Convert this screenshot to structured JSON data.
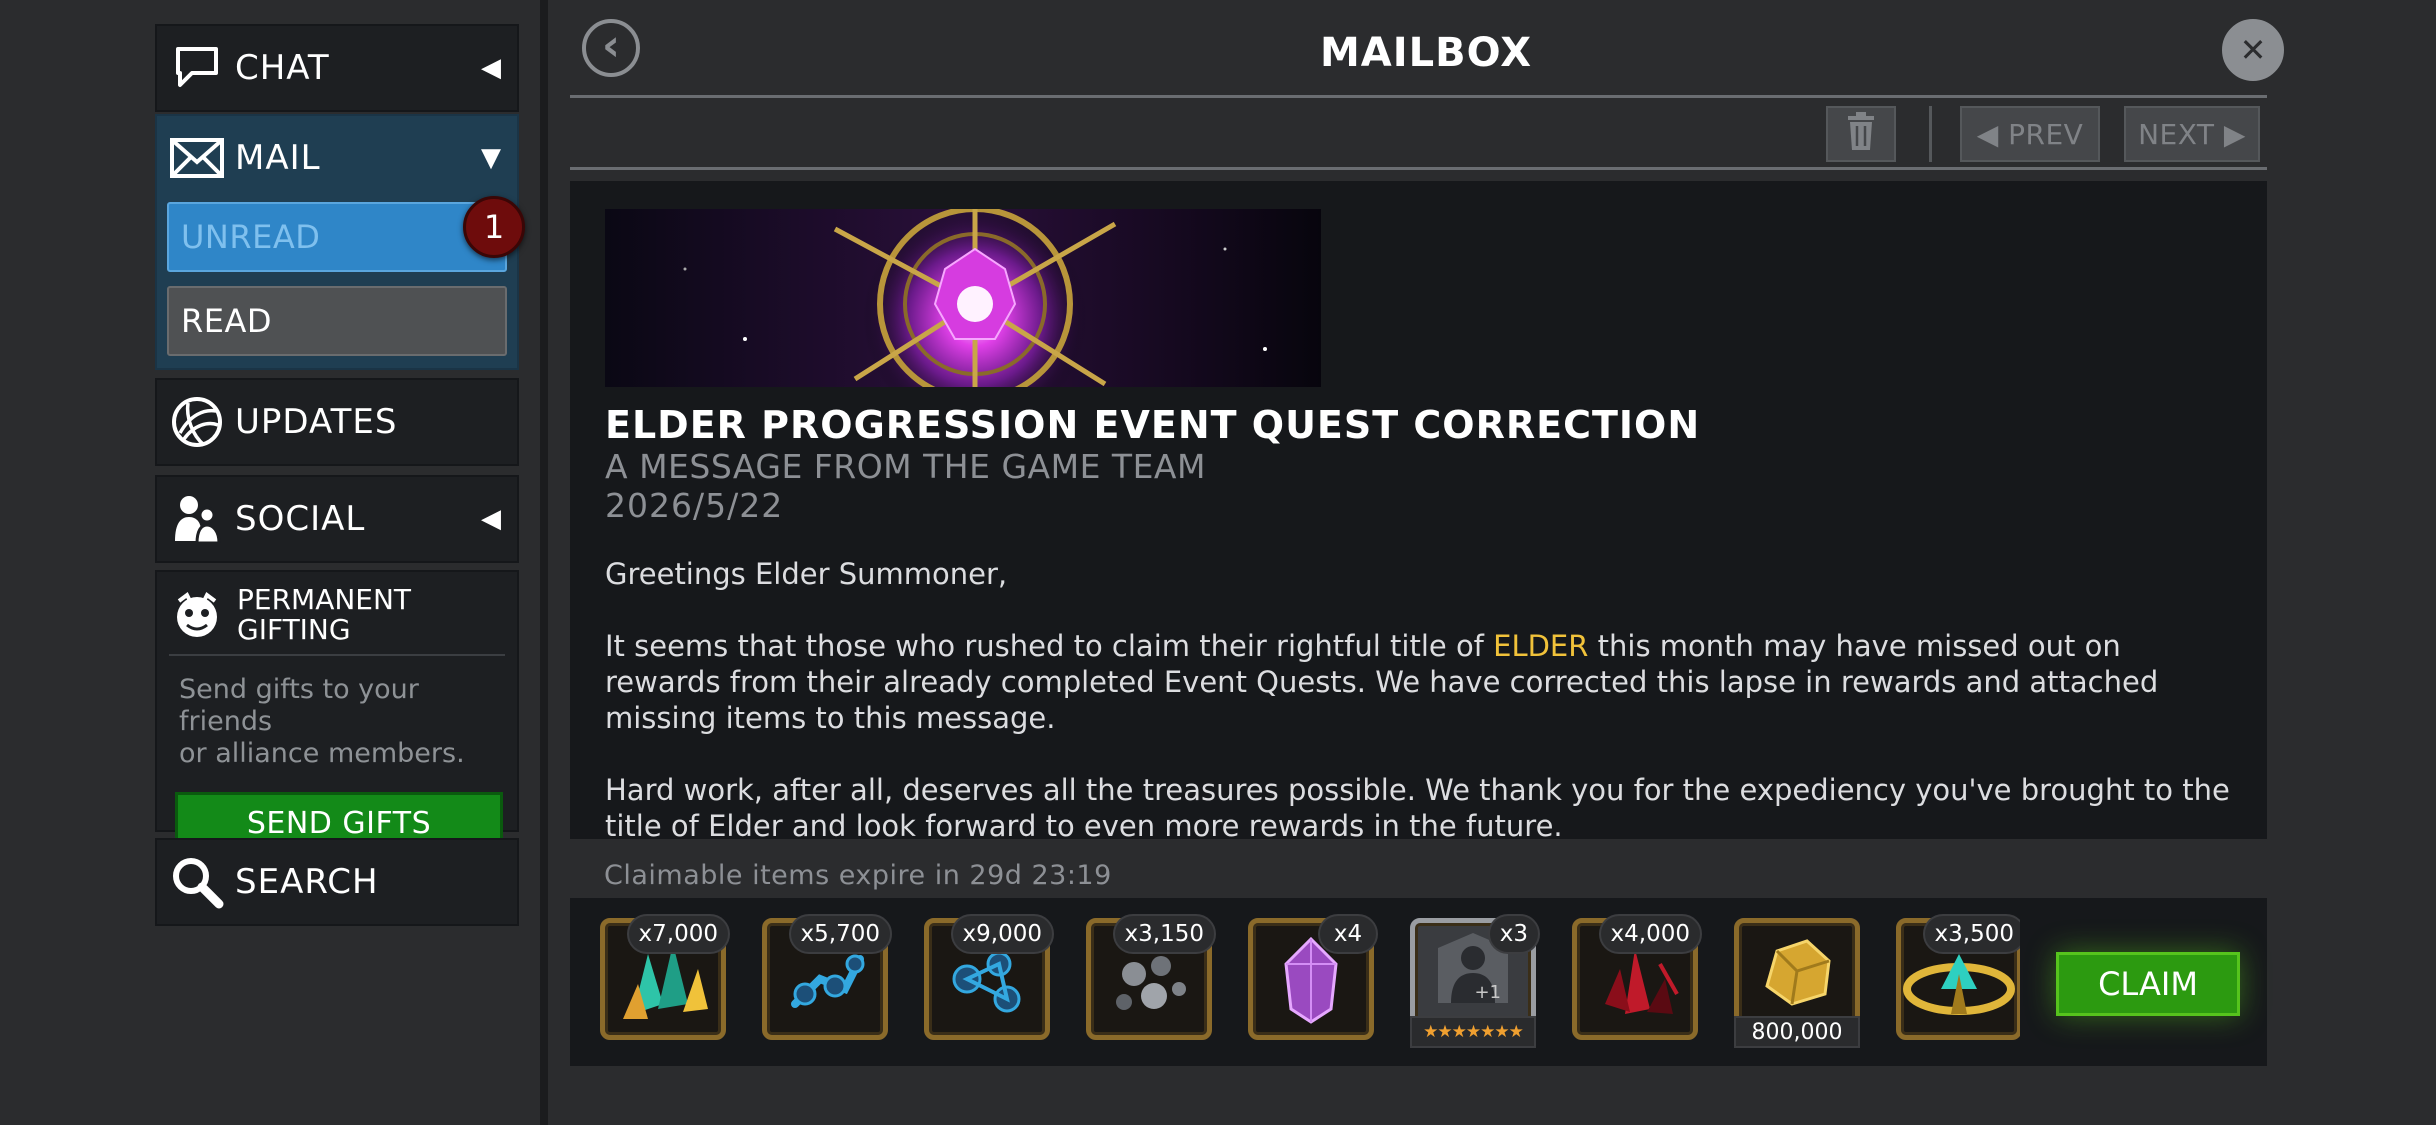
{
  "sidebar": {
    "chat": {
      "label": "CHAT",
      "arrow": "◀"
    },
    "mail": {
      "label": "MAIL",
      "arrow": "▼",
      "unread_label": "UNREAD",
      "unread_count": "1",
      "read_label": "READ"
    },
    "updates": {
      "label": "UPDATES"
    },
    "social": {
      "label": "SOCIAL",
      "arrow": "◀"
    },
    "gifting": {
      "title_line1": "PERMANENT",
      "title_line2": "GIFTING",
      "desc_line1": "Send gifts to your friends",
      "desc_line2": "or alliance members.",
      "button": "SEND GIFTS"
    },
    "search": {
      "label": "SEARCH"
    }
  },
  "header": {
    "title": "MAILBOX",
    "back_glyph": "‹",
    "close_glyph": "✕"
  },
  "toolbar": {
    "prev_label": "◀ PREV",
    "next_label": "NEXT ▶"
  },
  "message": {
    "title": "ELDER PROGRESSION EVENT QUEST CORRECTION",
    "subtitle": "A MESSAGE FROM THE GAME TEAM",
    "date": "2026/5/22",
    "greeting": "Greetings Elder Summoner,",
    "p1_before": "It seems that those who rushed to claim their rightful title of ",
    "p1_highlight": "ELDER",
    "p1_after": " this month may have missed out on rewards from their already completed Event Quests. We have corrected this lapse in rewards and attached missing items to this message.",
    "p2": "Hard work, after all, deserves all the treasures possible. We thank you for the expediency you've brought to the title of Elder and look forward to even more rewards in the future."
  },
  "rewards": {
    "expire_text": "Claimable items expire in 29d 23:19",
    "claim_label": "CLAIM",
    "items": [
      {
        "icon": "teal-shard-icon",
        "qty": "x7,000"
      },
      {
        "icon": "blue-catalyst-icon",
        "qty": "x5,700"
      },
      {
        "icon": "blue-catalyst-cluster-icon",
        "qty": "x9,000"
      },
      {
        "icon": "grey-orb-cluster-icon",
        "qty": "x3,150"
      },
      {
        "icon": "purple-crystal-icon",
        "qty": "x4"
      },
      {
        "icon": "champion-silhouette-icon",
        "qty": "x3",
        "foot": "★★★★★★★",
        "foot_overlay": "+1"
      },
      {
        "icon": "red-shard-icon",
        "qty": "x4,000"
      },
      {
        "icon": "gold-icon",
        "qty": "",
        "foot": "800,000"
      },
      {
        "icon": "gold-teal-relic-icon",
        "qty": "x3,500"
      }
    ]
  },
  "colors": {
    "highlight": "#f1c23a",
    "claim_green": "#2c9a10",
    "send_green": "#138a18",
    "unread_blue": "#2f86c8",
    "badge_red": "#6e0c0c"
  }
}
